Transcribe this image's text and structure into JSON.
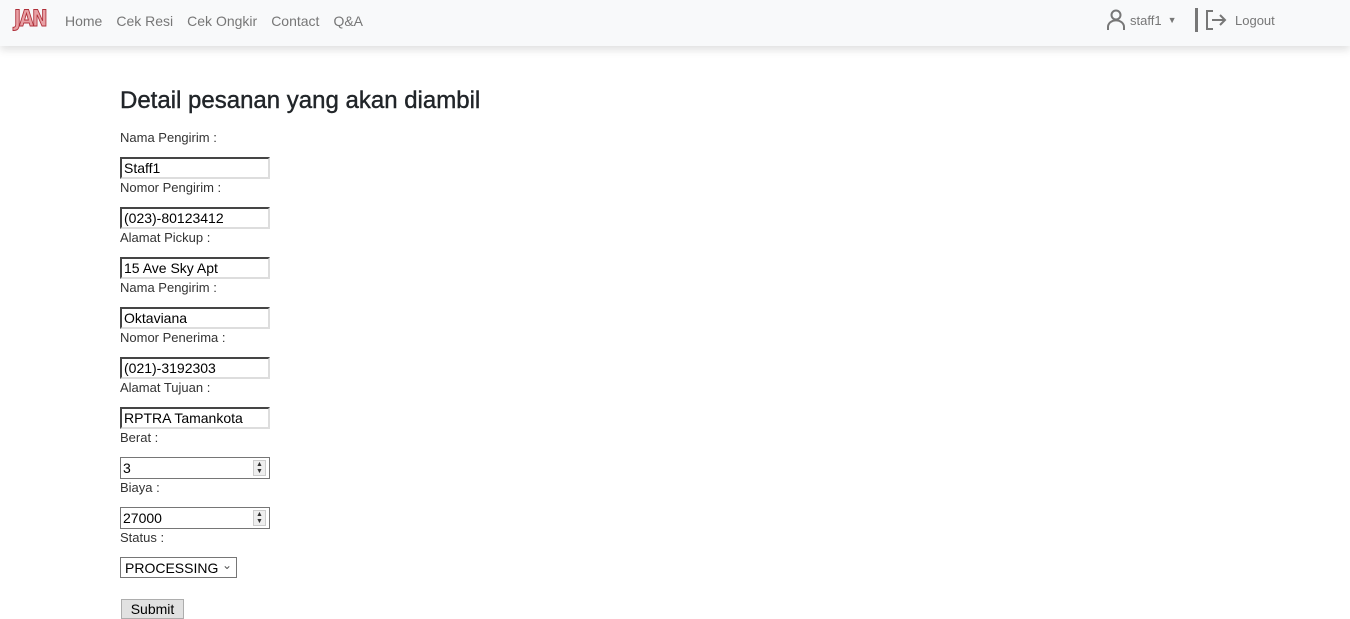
{
  "nav": {
    "logo": "JAN",
    "links": [
      "Home",
      "Cek Resi",
      "Cek Ongkir",
      "Contact",
      "Q&A"
    ],
    "user": "staff1",
    "logout": "Logout"
  },
  "page": {
    "title": "Detail pesanan yang akan diambil"
  },
  "form": {
    "fields": [
      {
        "label": "Nama Pengirim :",
        "value": "Staff1"
      },
      {
        "label": "Nomor Pengirim :",
        "value": "(023)-80123412"
      },
      {
        "label": "Alamat Pickup :",
        "value": "15 Ave Sky Apt"
      },
      {
        "label": "Nama Pengirim :",
        "value": "Oktaviana"
      },
      {
        "label": "Nomor Penerima :",
        "value": "(021)-3192303"
      },
      {
        "label": "Alamat Tujuan :",
        "value": "RPTRA Tamankota"
      },
      {
        "label": "Berat :",
        "value": "3"
      },
      {
        "label": "Biaya :",
        "value": "27000"
      },
      {
        "label": "Status :",
        "value": "PROCESSING"
      }
    ],
    "submit": "Submit"
  }
}
